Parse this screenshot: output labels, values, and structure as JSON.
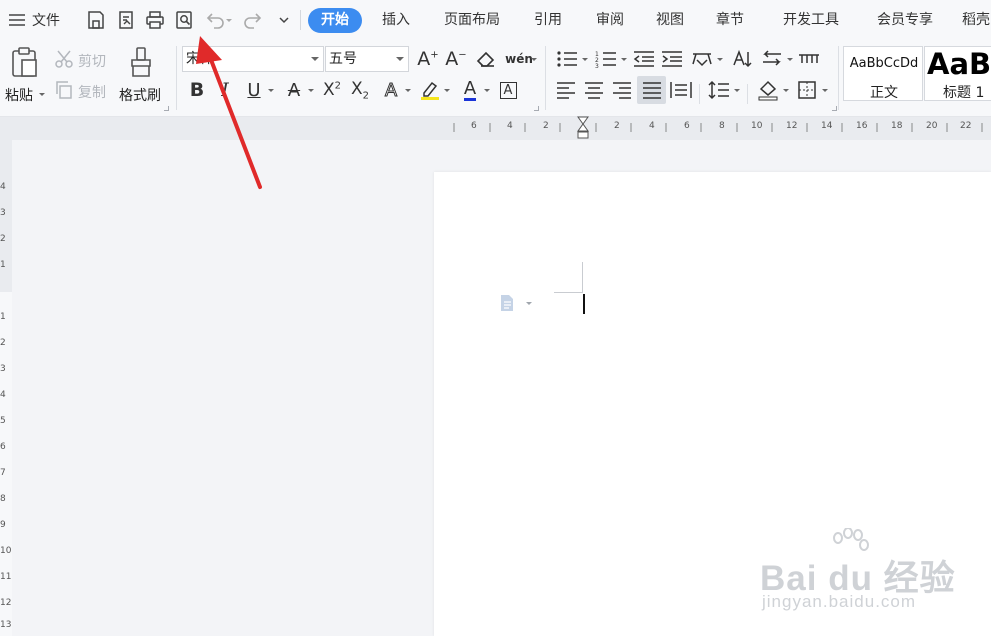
{
  "menubar": {
    "file_label": "文件",
    "tabs": [
      {
        "label": "开始",
        "active": true
      },
      {
        "label": "插入"
      },
      {
        "label": "页面布局"
      },
      {
        "label": "引用"
      },
      {
        "label": "审阅"
      },
      {
        "label": "视图"
      },
      {
        "label": "章节"
      },
      {
        "label": "开发工具"
      },
      {
        "label": "会员专享"
      },
      {
        "label": "稻壳"
      }
    ]
  },
  "ribbon": {
    "paste_label": "粘贴",
    "cut_label": "剪切",
    "copy_label": "复制",
    "format_painter_label": "格式刷",
    "font_name": "宋体",
    "font_size": "五号",
    "phonetic_glyph": "wén",
    "styles": [
      {
        "preview": "AaBbCcDd",
        "name": "正文"
      },
      {
        "preview": "AaBl",
        "name": "标题 1"
      }
    ]
  },
  "hruler": {
    "labels": [
      "6",
      "4",
      "2",
      "2",
      "4",
      "6",
      "8",
      "10",
      "12",
      "14",
      "16",
      "18",
      "20",
      "22"
    ]
  },
  "vruler": {
    "labels": [
      "4",
      "3",
      "2",
      "1",
      "1",
      "2",
      "3",
      "4",
      "5",
      "6",
      "7",
      "8",
      "9",
      "10",
      "11",
      "12",
      "13"
    ]
  },
  "watermark": {
    "brand": "Bai du 经验",
    "url": "jingyan.baidu.com"
  },
  "colors": {
    "accent": "#3c8cf0",
    "highlight": "#f5e51d",
    "font_color": "#1a34d8",
    "arrow": "#e02a2a"
  }
}
